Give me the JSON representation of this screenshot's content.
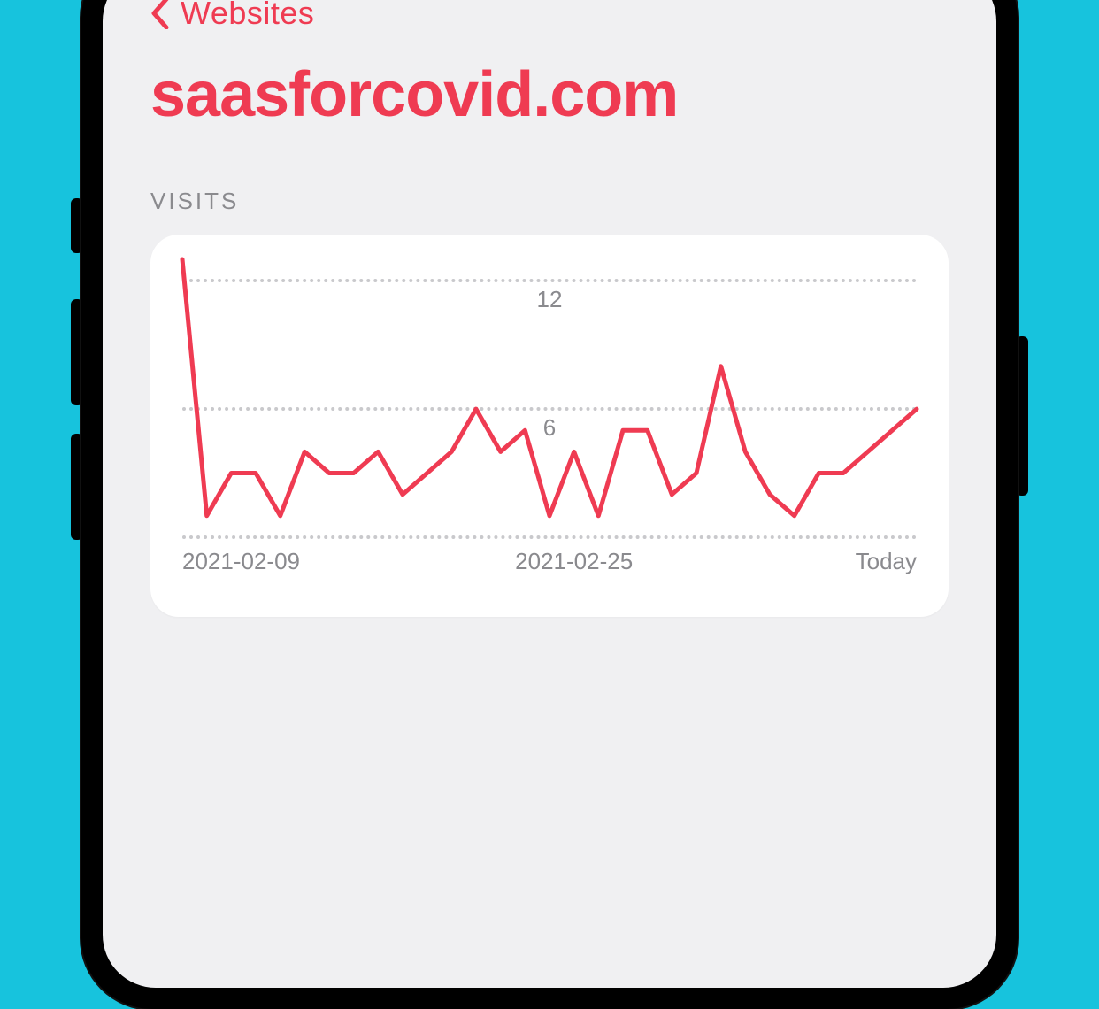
{
  "nav": {
    "back_label": "Websites"
  },
  "page": {
    "title": "saasforcovid.com",
    "section_label": "VISITS"
  },
  "colors": {
    "accent": "#ef3b52",
    "grid": "#c9c9cc",
    "muted": "#8a8a8e",
    "card_bg": "#ffffff",
    "screen_bg": "#f0f0f2",
    "outer_bg": "#17c3dd"
  },
  "chart_data": {
    "type": "line",
    "title": "",
    "xlabel": "",
    "ylabel": "",
    "ylim": [
      0,
      13
    ],
    "y_ticks": [
      0,
      6,
      12
    ],
    "y_tick_labels": [
      "",
      "6",
      "12"
    ],
    "x_tick_positions": [
      0,
      16,
      30
    ],
    "x_tick_labels": [
      "2021-02-09",
      "2021-02-25",
      "Today"
    ],
    "values": [
      13,
      1,
      3,
      3,
      1,
      4,
      3,
      3,
      4,
      2,
      3,
      4,
      6,
      4,
      5,
      1,
      4,
      1,
      5,
      5,
      2,
      3,
      8,
      4,
      2,
      1,
      3,
      3,
      4,
      5,
      6
    ]
  }
}
